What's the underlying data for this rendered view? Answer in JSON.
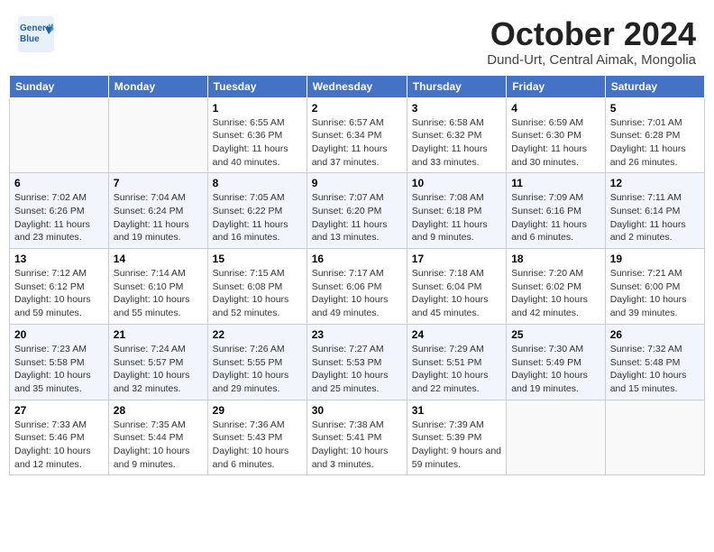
{
  "header": {
    "logo_text_general": "General",
    "logo_text_blue": "Blue",
    "month_title": "October 2024",
    "subtitle": "Dund-Urt, Central Aimak, Mongolia"
  },
  "days_of_week": [
    "Sunday",
    "Monday",
    "Tuesday",
    "Wednesday",
    "Thursday",
    "Friday",
    "Saturday"
  ],
  "weeks": [
    [
      {
        "day": "",
        "sunrise": "",
        "sunset": "",
        "daylight": ""
      },
      {
        "day": "",
        "sunrise": "",
        "sunset": "",
        "daylight": ""
      },
      {
        "day": "1",
        "sunrise": "Sunrise: 6:55 AM",
        "sunset": "Sunset: 6:36 PM",
        "daylight": "Daylight: 11 hours and 40 minutes."
      },
      {
        "day": "2",
        "sunrise": "Sunrise: 6:57 AM",
        "sunset": "Sunset: 6:34 PM",
        "daylight": "Daylight: 11 hours and 37 minutes."
      },
      {
        "day": "3",
        "sunrise": "Sunrise: 6:58 AM",
        "sunset": "Sunset: 6:32 PM",
        "daylight": "Daylight: 11 hours and 33 minutes."
      },
      {
        "day": "4",
        "sunrise": "Sunrise: 6:59 AM",
        "sunset": "Sunset: 6:30 PM",
        "daylight": "Daylight: 11 hours and 30 minutes."
      },
      {
        "day": "5",
        "sunrise": "Sunrise: 7:01 AM",
        "sunset": "Sunset: 6:28 PM",
        "daylight": "Daylight: 11 hours and 26 minutes."
      }
    ],
    [
      {
        "day": "6",
        "sunrise": "Sunrise: 7:02 AM",
        "sunset": "Sunset: 6:26 PM",
        "daylight": "Daylight: 11 hours and 23 minutes."
      },
      {
        "day": "7",
        "sunrise": "Sunrise: 7:04 AM",
        "sunset": "Sunset: 6:24 PM",
        "daylight": "Daylight: 11 hours and 19 minutes."
      },
      {
        "day": "8",
        "sunrise": "Sunrise: 7:05 AM",
        "sunset": "Sunset: 6:22 PM",
        "daylight": "Daylight: 11 hours and 16 minutes."
      },
      {
        "day": "9",
        "sunrise": "Sunrise: 7:07 AM",
        "sunset": "Sunset: 6:20 PM",
        "daylight": "Daylight: 11 hours and 13 minutes."
      },
      {
        "day": "10",
        "sunrise": "Sunrise: 7:08 AM",
        "sunset": "Sunset: 6:18 PM",
        "daylight": "Daylight: 11 hours and 9 minutes."
      },
      {
        "day": "11",
        "sunrise": "Sunrise: 7:09 AM",
        "sunset": "Sunset: 6:16 PM",
        "daylight": "Daylight: 11 hours and 6 minutes."
      },
      {
        "day": "12",
        "sunrise": "Sunrise: 7:11 AM",
        "sunset": "Sunset: 6:14 PM",
        "daylight": "Daylight: 11 hours and 2 minutes."
      }
    ],
    [
      {
        "day": "13",
        "sunrise": "Sunrise: 7:12 AM",
        "sunset": "Sunset: 6:12 PM",
        "daylight": "Daylight: 10 hours and 59 minutes."
      },
      {
        "day": "14",
        "sunrise": "Sunrise: 7:14 AM",
        "sunset": "Sunset: 6:10 PM",
        "daylight": "Daylight: 10 hours and 55 minutes."
      },
      {
        "day": "15",
        "sunrise": "Sunrise: 7:15 AM",
        "sunset": "Sunset: 6:08 PM",
        "daylight": "Daylight: 10 hours and 52 minutes."
      },
      {
        "day": "16",
        "sunrise": "Sunrise: 7:17 AM",
        "sunset": "Sunset: 6:06 PM",
        "daylight": "Daylight: 10 hours and 49 minutes."
      },
      {
        "day": "17",
        "sunrise": "Sunrise: 7:18 AM",
        "sunset": "Sunset: 6:04 PM",
        "daylight": "Daylight: 10 hours and 45 minutes."
      },
      {
        "day": "18",
        "sunrise": "Sunrise: 7:20 AM",
        "sunset": "Sunset: 6:02 PM",
        "daylight": "Daylight: 10 hours and 42 minutes."
      },
      {
        "day": "19",
        "sunrise": "Sunrise: 7:21 AM",
        "sunset": "Sunset: 6:00 PM",
        "daylight": "Daylight: 10 hours and 39 minutes."
      }
    ],
    [
      {
        "day": "20",
        "sunrise": "Sunrise: 7:23 AM",
        "sunset": "Sunset: 5:58 PM",
        "daylight": "Daylight: 10 hours and 35 minutes."
      },
      {
        "day": "21",
        "sunrise": "Sunrise: 7:24 AM",
        "sunset": "Sunset: 5:57 PM",
        "daylight": "Daylight: 10 hours and 32 minutes."
      },
      {
        "day": "22",
        "sunrise": "Sunrise: 7:26 AM",
        "sunset": "Sunset: 5:55 PM",
        "daylight": "Daylight: 10 hours and 29 minutes."
      },
      {
        "day": "23",
        "sunrise": "Sunrise: 7:27 AM",
        "sunset": "Sunset: 5:53 PM",
        "daylight": "Daylight: 10 hours and 25 minutes."
      },
      {
        "day": "24",
        "sunrise": "Sunrise: 7:29 AM",
        "sunset": "Sunset: 5:51 PM",
        "daylight": "Daylight: 10 hours and 22 minutes."
      },
      {
        "day": "25",
        "sunrise": "Sunrise: 7:30 AM",
        "sunset": "Sunset: 5:49 PM",
        "daylight": "Daylight: 10 hours and 19 minutes."
      },
      {
        "day": "26",
        "sunrise": "Sunrise: 7:32 AM",
        "sunset": "Sunset: 5:48 PM",
        "daylight": "Daylight: 10 hours and 15 minutes."
      }
    ],
    [
      {
        "day": "27",
        "sunrise": "Sunrise: 7:33 AM",
        "sunset": "Sunset: 5:46 PM",
        "daylight": "Daylight: 10 hours and 12 minutes."
      },
      {
        "day": "28",
        "sunrise": "Sunrise: 7:35 AM",
        "sunset": "Sunset: 5:44 PM",
        "daylight": "Daylight: 10 hours and 9 minutes."
      },
      {
        "day": "29",
        "sunrise": "Sunrise: 7:36 AM",
        "sunset": "Sunset: 5:43 PM",
        "daylight": "Daylight: 10 hours and 6 minutes."
      },
      {
        "day": "30",
        "sunrise": "Sunrise: 7:38 AM",
        "sunset": "Sunset: 5:41 PM",
        "daylight": "Daylight: 10 hours and 3 minutes."
      },
      {
        "day": "31",
        "sunrise": "Sunrise: 7:39 AM",
        "sunset": "Sunset: 5:39 PM",
        "daylight": "Daylight: 9 hours and 59 minutes."
      },
      {
        "day": "",
        "sunrise": "",
        "sunset": "",
        "daylight": ""
      },
      {
        "day": "",
        "sunrise": "",
        "sunset": "",
        "daylight": ""
      }
    ]
  ]
}
